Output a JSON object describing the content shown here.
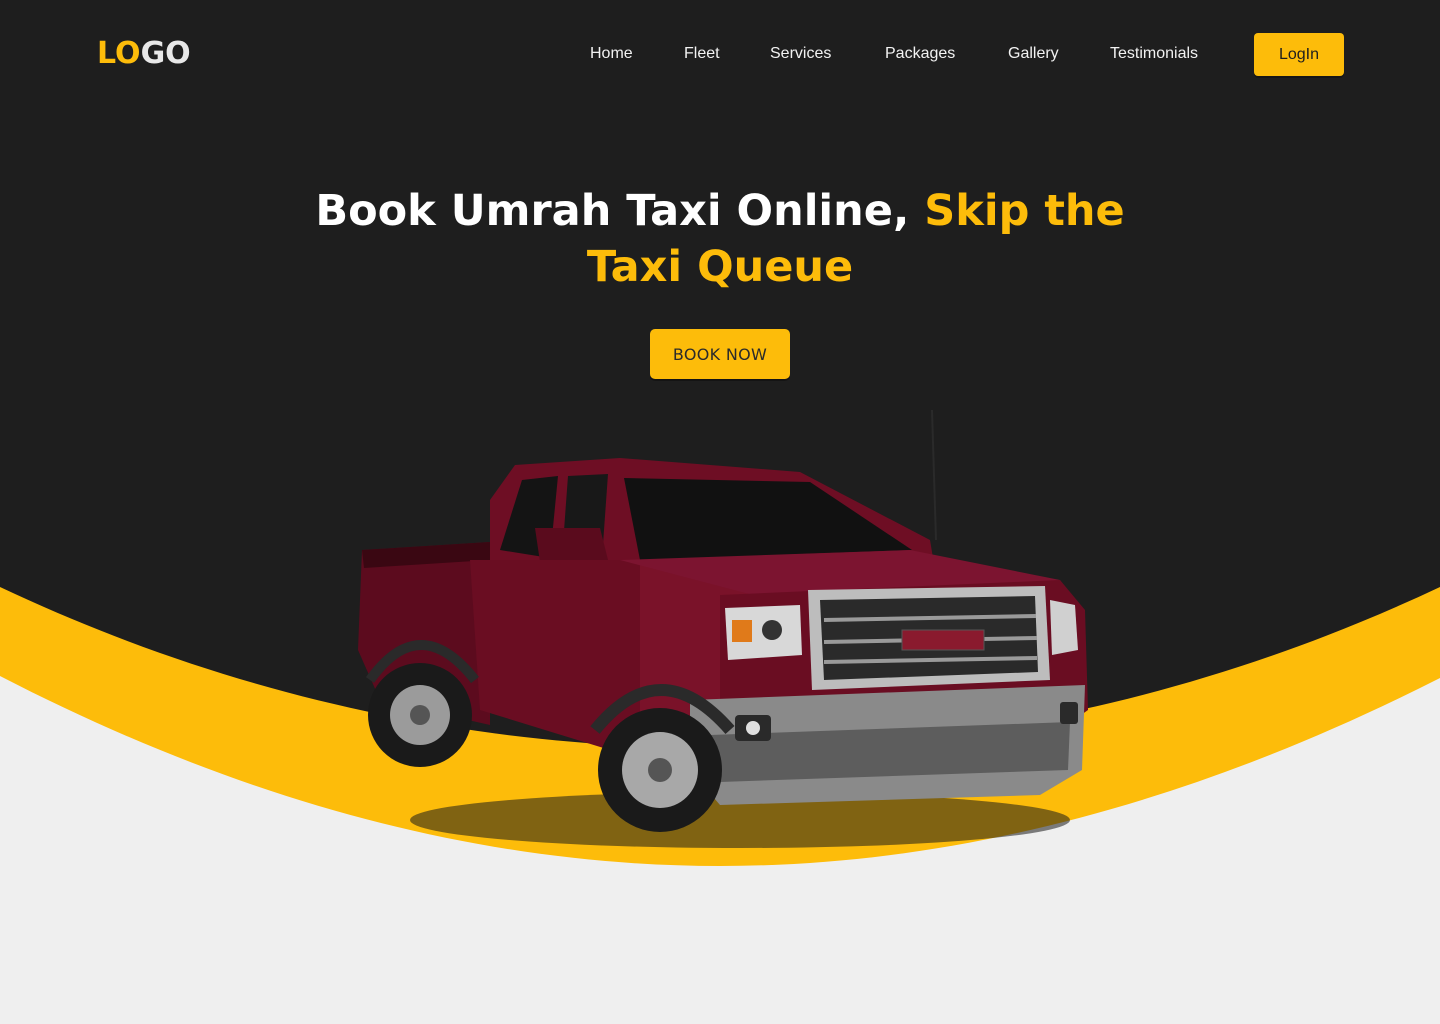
{
  "brand": {
    "logo_part1": "LO",
    "logo_part2": "GO"
  },
  "nav": {
    "items": [
      {
        "label": "Home"
      },
      {
        "label": "Fleet"
      },
      {
        "label": "Services"
      },
      {
        "label": "Packages"
      },
      {
        "label": "Gallery"
      },
      {
        "label": "Testimonials"
      }
    ],
    "login_label": "LogIn"
  },
  "hero": {
    "title_plain": "Book Umrah Taxi Online, ",
    "title_highlight_line1": "Skip the",
    "title_highlight_line2": "Taxi Queue",
    "cta_label": "BOOK NOW"
  },
  "theme": {
    "dark_bg": "#1e1e1e",
    "accent": "#fdbc0a",
    "light_bg": "#efefef",
    "truck_color": "#6e0e24"
  }
}
